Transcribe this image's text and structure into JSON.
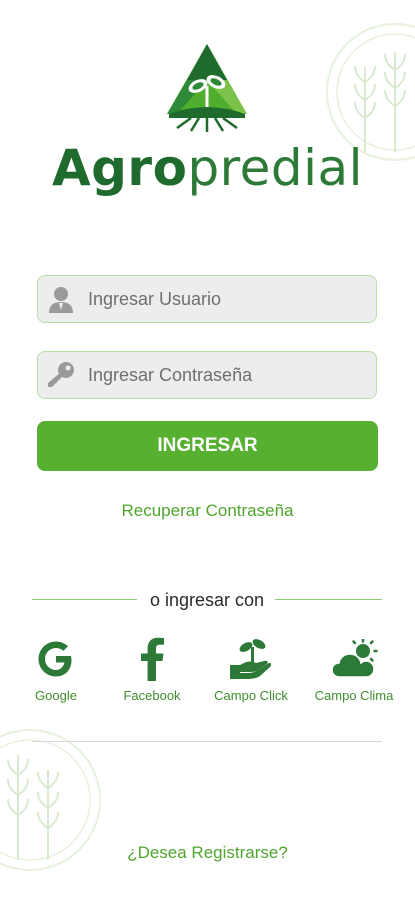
{
  "brand": {
    "name_bold": "Agro",
    "name_light": "predial"
  },
  "login": {
    "user_placeholder": "Ingresar Usuario",
    "password_placeholder": "Ingresar Contraseña",
    "submit_label": "INGRESAR",
    "recover_label": "Recuperar Contraseña"
  },
  "alt_login": {
    "divider_label": "o ingresar con",
    "options": [
      {
        "label": "Google",
        "icon": "google-icon"
      },
      {
        "label": "Facebook",
        "icon": "facebook-icon"
      },
      {
        "label": "Campo Click",
        "icon": "hand-plant-icon"
      },
      {
        "label": "Campo Clima",
        "icon": "cloud-sun-icon"
      }
    ]
  },
  "register_label": "¿Desea Registrarse?",
  "colors": {
    "primary": "#58b031",
    "brand_dark": "#1f6b2e",
    "link": "#4ea62c",
    "field_border": "#b9dfa7",
    "field_bg": "#ededed"
  }
}
